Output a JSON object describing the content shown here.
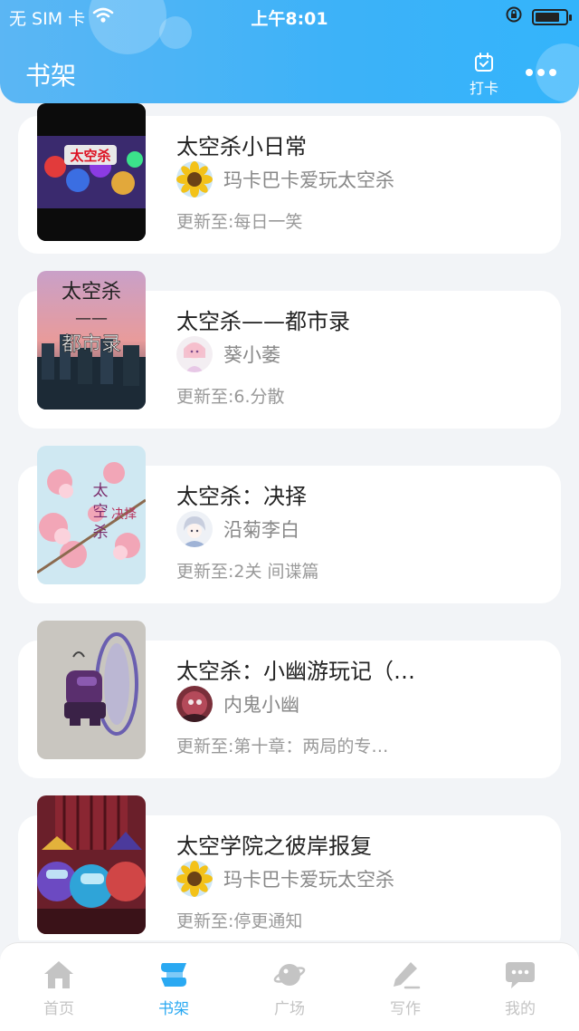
{
  "status_bar": {
    "carrier": "无 SIM 卡",
    "time": "上午8:01",
    "battery_level": 0.8
  },
  "header": {
    "title": "书架",
    "checkin_label": "打卡",
    "more_icon": "more-dots-icon",
    "checkin_icon": "calendar-check-icon"
  },
  "books": [
    {
      "title": "太空杀小日常",
      "author": "玛卡巴卡爱玩太空杀",
      "update_prefix": "更新至:",
      "update_text": "每日一笑"
    },
    {
      "title": "太空杀——都市录",
      "author": "葵小萎",
      "update_prefix": "更新至:",
      "update_text": "6.分散"
    },
    {
      "title": "太空杀：决择",
      "author": "沿菊李白",
      "update_prefix": "更新至:",
      "update_text": "2关  间谍篇"
    },
    {
      "title": "太空杀：小幽游玩记（…",
      "author": "内鬼小幽",
      "update_prefix": "更新至:",
      "update_text": "第十章：两局的专…"
    },
    {
      "title": "太空学院之彼岸报复",
      "author": "玛卡巴卡爱玩太空杀",
      "update_prefix": "更新至:",
      "update_text": "停更通知"
    }
  ],
  "covers": {
    "cover_1_text": "太空杀",
    "cover_2_text": [
      "太空杀",
      "——",
      "都市录"
    ],
    "cover_3_text": [
      "太",
      "空",
      "杀",
      "决择"
    ]
  },
  "nav": [
    {
      "label": "首页",
      "icon": "home-icon"
    },
    {
      "label": "书架",
      "icon": "bookshelf-icon",
      "active": true
    },
    {
      "label": "广场",
      "icon": "planet-icon"
    },
    {
      "label": "写作",
      "icon": "pen-icon"
    },
    {
      "label": "我的",
      "icon": "chat-bubble-icon"
    }
  ],
  "colors": {
    "header_start": "#5bb6f4",
    "header_end": "#34b4fb",
    "nav_active": "#2aa9f2",
    "nav_inactive": "#c4c4c4"
  }
}
